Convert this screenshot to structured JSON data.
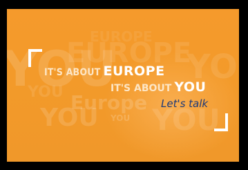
{
  "banner": {
    "line1_small": "IT'S ABOUT",
    "line1_big": "EUROPE",
    "line2_small": "IT'S ABOUT",
    "line2_big": "YOU",
    "tagline": "Let's talk"
  },
  "background_words": [
    "YOU",
    "EUROPE",
    "YOU",
    "Europe",
    "YOU",
    "YOU",
    "YOU",
    "YOU",
    "EUROPE"
  ],
  "colors": {
    "frame": "#000000",
    "banner": "#f59a2c",
    "tagline": "#1d3a7a",
    "text": "#ffffff"
  }
}
